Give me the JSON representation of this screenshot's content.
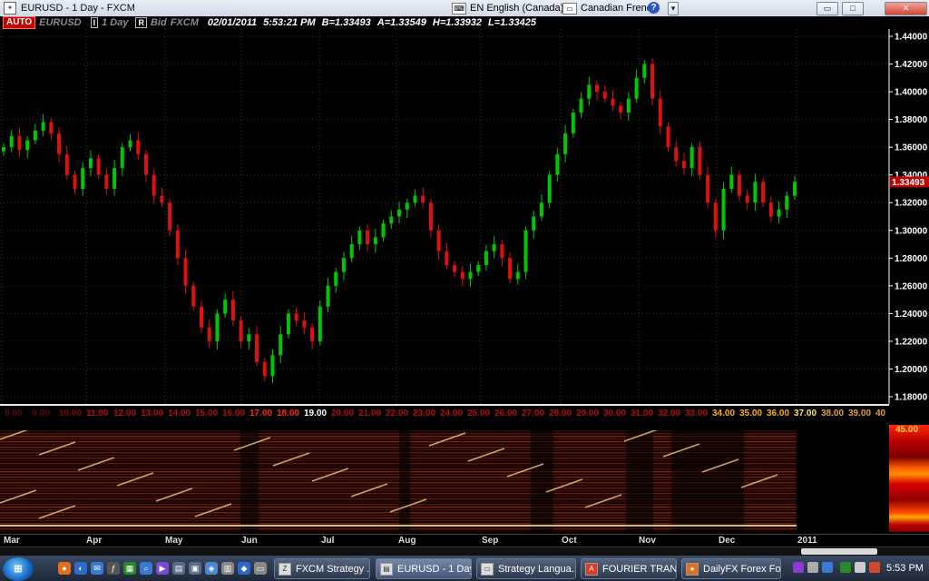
{
  "window": {
    "title": "EURUSD - 1 Day - FXCM",
    "lang_input": "EN English (Canada)",
    "lang_keyboard": "Canadian French",
    "help_glyph": "?",
    "btn_restore_glyph": "▭",
    "btn_maximize_glyph": "□",
    "btn_close_glyph": "✕"
  },
  "info": {
    "auto": "AUTO",
    "symbol": "EURUSD",
    "interval_btn": "I",
    "interval": "1 Day",
    "range_btn": "R",
    "source": "Bid",
    "feed": "FXCM",
    "datetime": "02/01/2011",
    "time": "5:53:21 PM",
    "bid": "B=1.33493",
    "ask": "A=1.33549",
    "high": "H=1.33932",
    "low": "L=1.33425"
  },
  "price_axis": [
    "1.44000",
    "1.42000",
    "1.40000",
    "1.38000",
    "1.36000",
    "1.34000",
    "1.33493",
    "1.32000",
    "1.30000",
    "1.28000",
    "1.26000",
    "1.24000",
    "1.22000",
    "1.20000",
    "1.18000"
  ],
  "cycle_row": [
    "8.00",
    "9.00",
    "10.00",
    "11.00",
    "12.00",
    "13.00",
    "14.00",
    "15.00",
    "16.00",
    "17.00",
    "18.00",
    "19.00",
    "20.00",
    "21.00",
    "22.00",
    "23.00",
    "24.00",
    "25.00",
    "26.00",
    "27.00",
    "28.00",
    "29.00",
    "30.00",
    "31.00",
    "32.00",
    "33.00",
    "34.00",
    "35.00",
    "36.00",
    "37.00",
    "38.00",
    "39.00",
    "40"
  ],
  "heat_scale_label": "45.00",
  "x_axis": [
    "Mar",
    "Apr",
    "May",
    "Jun",
    "Jul",
    "Aug",
    "Sep",
    "Oct",
    "Nov",
    "Dec",
    "2011"
  ],
  "colors": {
    "up": "#00c800",
    "down": "#e01010",
    "axis": "#ffffff",
    "current_price_box": "#c00000"
  },
  "chart_data": {
    "type": "candlestick",
    "title": "EURUSD - 1 Day - FXCM",
    "xlabel": "",
    "ylabel": "",
    "ylim": [
      1.175,
      1.45
    ],
    "current_price": 1.33493,
    "x": [
      "Mar",
      "Apr",
      "May",
      "Jun",
      "Jul",
      "Aug",
      "Sep",
      "Oct",
      "Nov",
      "Dec",
      "2011"
    ],
    "series": [
      {
        "values": [
          1.36,
          1.368,
          1.358,
          1.365,
          1.372,
          1.378,
          1.37,
          1.355,
          1.34,
          1.33,
          1.345,
          1.352,
          1.34,
          1.33,
          1.345,
          1.36,
          1.365,
          1.355,
          1.34,
          1.325,
          1.32,
          1.3,
          1.28,
          1.26,
          1.245,
          1.23,
          1.22,
          1.24,
          1.25,
          1.235,
          1.22,
          1.225,
          1.205,
          1.195,
          1.21,
          1.225,
          1.24,
          1.235,
          1.23,
          1.22,
          1.245,
          1.26,
          1.27,
          1.28,
          1.29,
          1.3,
          1.29,
          1.295,
          1.305,
          1.31,
          1.315,
          1.32,
          1.325,
          1.32,
          1.3,
          1.285,
          1.275,
          1.27,
          1.265,
          1.27,
          1.275,
          1.285,
          1.29,
          1.28,
          1.265,
          1.27,
          1.3,
          1.31,
          1.32,
          1.34,
          1.355,
          1.37,
          1.385,
          1.395,
          1.405,
          1.4,
          1.395,
          1.39,
          1.385,
          1.395,
          1.41,
          1.42,
          1.395,
          1.375,
          1.36,
          1.35,
          1.345,
          1.36,
          1.34,
          1.32,
          1.3,
          1.33,
          1.34,
          1.325,
          1.32,
          1.335,
          1.32,
          1.31,
          1.315,
          1.325,
          1.335
        ]
      }
    ]
  }
}
